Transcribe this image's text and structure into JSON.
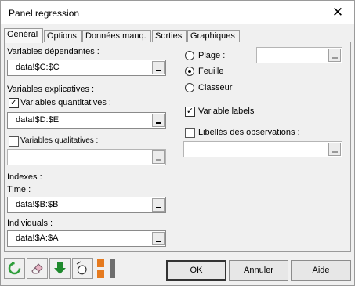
{
  "window": {
    "title": "Panel regression"
  },
  "tabs": [
    "Général",
    "Options",
    "Données manq.",
    "Sorties",
    "Graphiques"
  ],
  "general": {
    "dependent_label": "Variables dépendantes :",
    "dependent_value": "data!$C:$C",
    "explanatory_label": "Variables explicatives :",
    "quantitative_label": "Variables quantitatives :",
    "quantitative_checked": true,
    "quantitative_value": "data!$D:$E",
    "qualitative_label": "Variables qualitatives :",
    "qualitative_checked": false,
    "qualitative_value": "",
    "indexes_label": "Indexes :",
    "time_label": "Time :",
    "time_value": "data!$B:$B",
    "individuals_label": "Individuals :",
    "individuals_value": "data!$A:$A",
    "range_label": "Plage :",
    "range_value": "",
    "sheet_label": "Feuille",
    "workbook_label": "Classeur",
    "output_selected": "Feuille",
    "variable_labels_label": "Variable labels",
    "variable_labels_checked": true,
    "obs_labels_label": "Libellés des observations :",
    "obs_labels_checked": false,
    "obs_labels_value": ""
  },
  "footer": {
    "ok_label": "OK",
    "cancel_label": "Annuler",
    "help_label": "Aide"
  },
  "icons": [
    "reset-icon",
    "eraser-icon",
    "download-icon",
    "mouse-icon",
    "layout-toggle-icon"
  ],
  "colors": {
    "green": "#2f9e3b",
    "orange": "#e57a1f",
    "grey": "#6e6e6e"
  }
}
